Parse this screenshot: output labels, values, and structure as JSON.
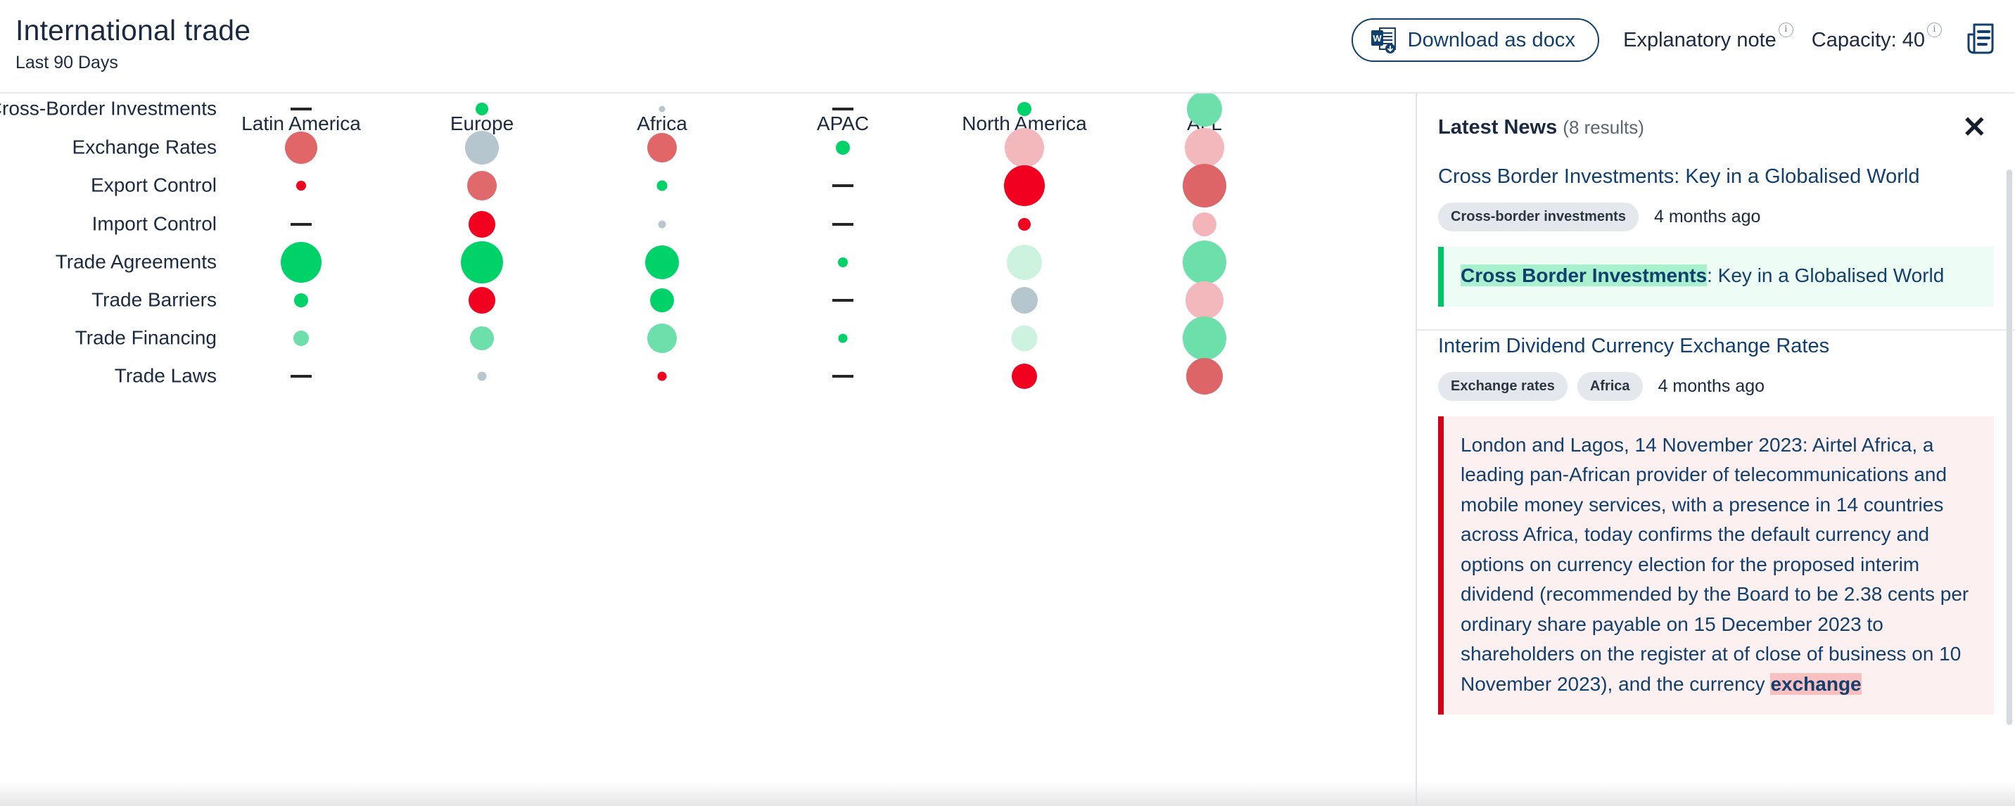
{
  "header": {
    "title": "International trade",
    "subtitle": "Last 90 Days",
    "download_label": "Download as docx",
    "explanatory_note": "Explanatory note",
    "capacity": "Capacity: 40",
    "info_glyph": "i",
    "word_icon_letter": "W"
  },
  "matrix": {
    "columns": [
      "Latin America",
      "Europe",
      "Africa",
      "APAC",
      "North America",
      "ALL"
    ],
    "rows": [
      "Cross-Border Investments",
      "Exchange Rates",
      "Export Control",
      "Import Control",
      "Trade Agreements",
      "Trade Barriers",
      "Trade Financing",
      "Trade Laws"
    ]
  },
  "chart_data": {
    "type": "heatmap",
    "title": "International trade",
    "subtitle": "Last 90 Days",
    "xlabel": "",
    "ylabel": "",
    "legend": "none",
    "grid": false,
    "note": "Bubble matrix: bubble radius encodes volume, fill color encodes sentiment (green positive, red negative, grey neutral). Empty cell shown as a dash.",
    "categories": [
      "Latin America",
      "Europe",
      "Africa",
      "APAC",
      "North America",
      "ALL"
    ],
    "rows": [
      {
        "name": "Cross-Border Investments",
        "cells": [
          {
            "col": "Latin America",
            "state": "empty",
            "size": 0,
            "color": "#262626"
          },
          {
            "col": "Europe",
            "state": "bubble",
            "size": 18,
            "color": "#00d26a"
          },
          {
            "col": "Africa",
            "state": "bubble",
            "size": 9,
            "color": "#b8c7cf"
          },
          {
            "col": "APAC",
            "state": "empty",
            "size": 0,
            "color": "#262626"
          },
          {
            "col": "North America",
            "state": "bubble",
            "size": 20,
            "color": "#00d26a"
          },
          {
            "col": "ALL",
            "state": "bubble",
            "size": 50,
            "color": "#6ddfab"
          }
        ]
      },
      {
        "name": "Exchange Rates",
        "cells": [
          {
            "col": "Latin America",
            "state": "bubble",
            "size": 46,
            "color": "#e06668"
          },
          {
            "col": "Europe",
            "state": "bubble",
            "size": 48,
            "color": "#b6c6cf"
          },
          {
            "col": "Africa",
            "state": "bubble",
            "size": 42,
            "color": "#e06668"
          },
          {
            "col": "APAC",
            "state": "bubble",
            "size": 20,
            "color": "#00d26a"
          },
          {
            "col": "North America",
            "state": "bubble",
            "size": 56,
            "color": "#f3b8bb"
          },
          {
            "col": "ALL",
            "state": "bubble",
            "size": 56,
            "color": "#f3b8bb"
          }
        ]
      },
      {
        "name": "Export Control",
        "cells": [
          {
            "col": "Latin America",
            "state": "bubble",
            "size": 14,
            "color": "#ef0020"
          },
          {
            "col": "Europe",
            "state": "bubble",
            "size": 42,
            "color": "#e0696c"
          },
          {
            "col": "Africa",
            "state": "bubble",
            "size": 15,
            "color": "#00d26a"
          },
          {
            "col": "APAC",
            "state": "empty",
            "size": 0,
            "color": "#262626"
          },
          {
            "col": "North America",
            "state": "bubble",
            "size": 58,
            "color": "#f2001f"
          },
          {
            "col": "ALL",
            "state": "bubble",
            "size": 62,
            "color": "#de6567"
          }
        ]
      },
      {
        "name": "Import Control",
        "cells": [
          {
            "col": "Latin America",
            "state": "empty",
            "size": 0,
            "color": "#262626"
          },
          {
            "col": "Europe",
            "state": "bubble",
            "size": 38,
            "color": "#f2001f"
          },
          {
            "col": "Africa",
            "state": "bubble",
            "size": 11,
            "color": "#b8c7cf"
          },
          {
            "col": "APAC",
            "state": "empty",
            "size": 0,
            "color": "#262626"
          },
          {
            "col": "North America",
            "state": "bubble",
            "size": 18,
            "color": "#f2001f"
          },
          {
            "col": "ALL",
            "state": "bubble",
            "size": 34,
            "color": "#f3b5b9"
          }
        ]
      },
      {
        "name": "Trade Agreements",
        "cells": [
          {
            "col": "Latin America",
            "state": "bubble",
            "size": 58,
            "color": "#00d26a"
          },
          {
            "col": "Europe",
            "state": "bubble",
            "size": 60,
            "color": "#00d26a"
          },
          {
            "col": "Africa",
            "state": "bubble",
            "size": 48,
            "color": "#00d26a"
          },
          {
            "col": "APAC",
            "state": "bubble",
            "size": 14,
            "color": "#00d26a"
          },
          {
            "col": "North America",
            "state": "bubble",
            "size": 50,
            "color": "#cdf2de"
          },
          {
            "col": "ALL",
            "state": "bubble",
            "size": 62,
            "color": "#6ddfab"
          }
        ]
      },
      {
        "name": "Trade Barriers",
        "cells": [
          {
            "col": "Latin America",
            "state": "bubble",
            "size": 20,
            "color": "#00d26a"
          },
          {
            "col": "Europe",
            "state": "bubble",
            "size": 38,
            "color": "#f2001f"
          },
          {
            "col": "Africa",
            "state": "bubble",
            "size": 34,
            "color": "#00d26a"
          },
          {
            "col": "APAC",
            "state": "empty",
            "size": 0,
            "color": "#262626"
          },
          {
            "col": "North America",
            "state": "bubble",
            "size": 38,
            "color": "#b6c6cf"
          },
          {
            "col": "ALL",
            "state": "bubble",
            "size": 54,
            "color": "#f3b8bb"
          }
        ]
      },
      {
        "name": "Trade Financing",
        "cells": [
          {
            "col": "Latin America",
            "state": "bubble",
            "size": 22,
            "color": "#6ddfab"
          },
          {
            "col": "Europe",
            "state": "bubble",
            "size": 34,
            "color": "#6ddfab"
          },
          {
            "col": "Africa",
            "state": "bubble",
            "size": 42,
            "color": "#6ddfab"
          },
          {
            "col": "APAC",
            "state": "bubble",
            "size": 13,
            "color": "#00d26a"
          },
          {
            "col": "North America",
            "state": "bubble",
            "size": 37,
            "color": "#cdf2de"
          },
          {
            "col": "ALL",
            "state": "bubble",
            "size": 62,
            "color": "#6ddfab"
          }
        ]
      },
      {
        "name": "Trade Laws",
        "cells": [
          {
            "col": "Latin America",
            "state": "empty",
            "size": 0,
            "color": "#262626"
          },
          {
            "col": "Europe",
            "state": "bubble",
            "size": 13,
            "color": "#b8c7cf"
          },
          {
            "col": "Africa",
            "state": "bubble",
            "size": 13,
            "color": "#f2001f"
          },
          {
            "col": "APAC",
            "state": "empty",
            "size": 0,
            "color": "#262626"
          },
          {
            "col": "North America",
            "state": "bubble",
            "size": 36,
            "color": "#f2001f"
          },
          {
            "col": "ALL",
            "state": "bubble",
            "size": 52,
            "color": "#de6567"
          }
        ]
      }
    ]
  },
  "news": {
    "title": "Latest News",
    "count": "(8 results)",
    "close_label": "✕",
    "items": [
      {
        "headline": "Cross Border Investments: Key in a Globalised World",
        "tags": [
          "Cross-border investments"
        ],
        "date": "4 months ago",
        "accent": "green",
        "snippet_pre": "",
        "snippet_highlight": "Cross Border Investments",
        "snippet_post": ": Key in a Globalised World"
      },
      {
        "headline": "Interim Dividend Currency Exchange Rates",
        "tags": [
          "Exchange rates",
          "Africa"
        ],
        "date": "4 months ago",
        "accent": "red",
        "snippet_pre": "London and Lagos, 14 November 2023: Airtel Africa, a leading pan-African provider of telecommunications and mobile money services, with a presence in 14 countries across Africa, today confirms the default currency and options on currency election for the proposed interim dividend (recommended by the Board to be 2.38 cents per ordinary share payable on 15 December 2023 to shareholders on the register at of close of business on 10 November 2023), and the currency ",
        "snippet_highlight": "exchange",
        "snippet_post": ""
      }
    ]
  },
  "colors": {
    "brand_navy": "#12406e",
    "text": "#1b2a41",
    "positive": "#00d26a",
    "negative": "#f2001f",
    "neutral": "#b6c6cf"
  }
}
